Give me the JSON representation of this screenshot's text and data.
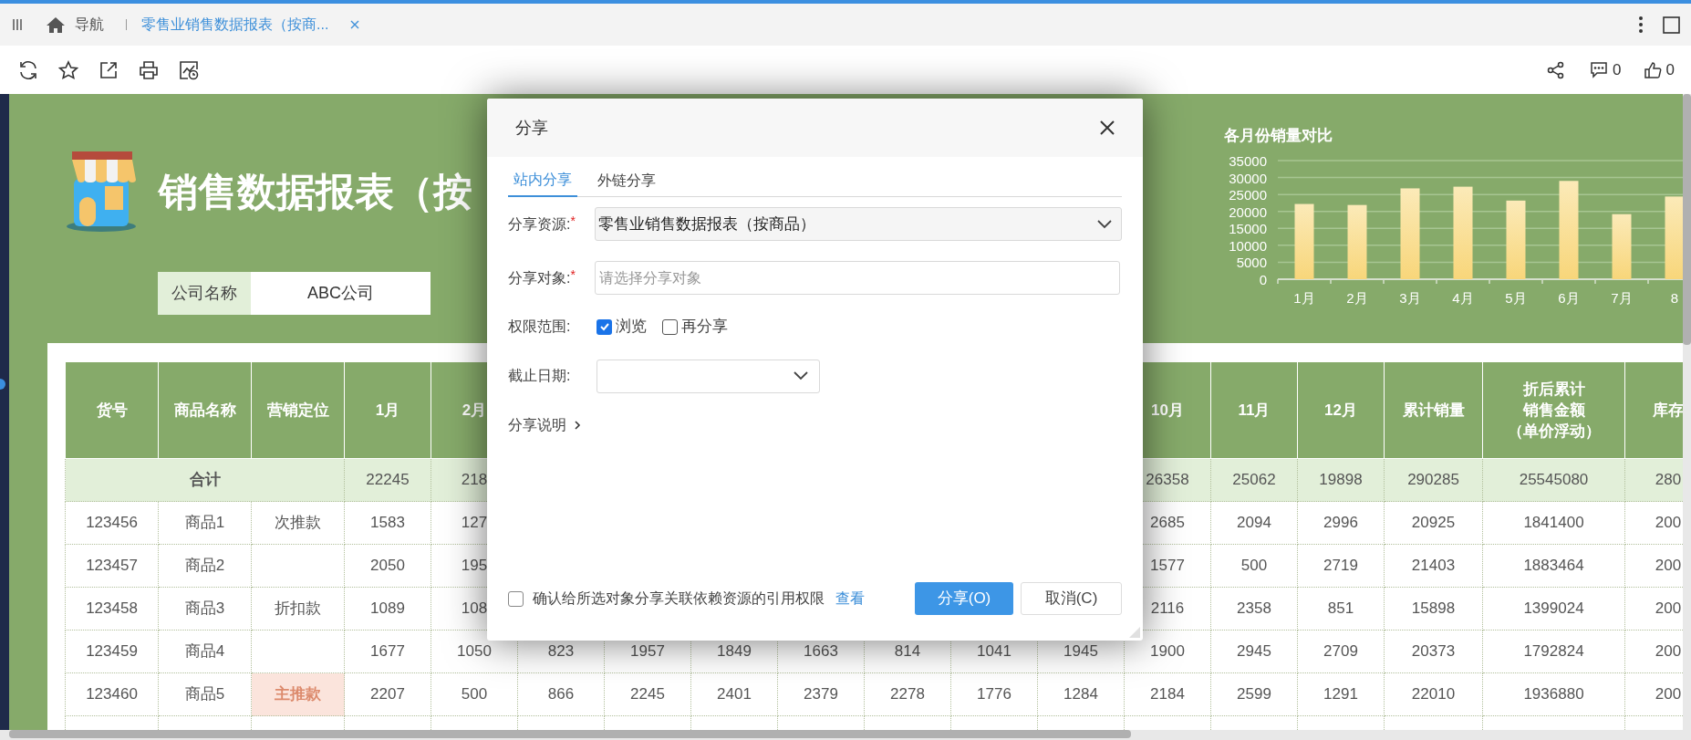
{
  "tab_bar": {
    "nav_label": "导航",
    "tabs": [
      {
        "label": "零售业销售数据报表（按商...",
        "selected": true
      }
    ]
  },
  "toolbar": {
    "comment_count": "0",
    "like_count": "0"
  },
  "report": {
    "title": "销售数据报表（按",
    "company": {
      "label": "公司名称",
      "value": "ABC公司"
    },
    "chart": {
      "chart_data": {
        "type": "bar",
        "title": "各月份销量对比",
        "categories": [
          "1月",
          "2月",
          "3月",
          "4月",
          "5月",
          "6月",
          "7月",
          "8"
        ],
        "series": [
          {
            "color": "#f8d67a",
            "values": [
              22200,
              21900,
              26800,
              27300,
              23200,
              29000,
              19200,
              24400
            ]
          }
        ],
        "ylim": [
          0,
          35000
        ],
        "yticks": [
          0,
          5000,
          10000,
          15000,
          20000,
          25000,
          30000,
          35000
        ],
        "grid": true
      }
    }
  },
  "table": {
    "columns": [
      "货号",
      "商品名称",
      "营销定位",
      "1月",
      "2月"
    ],
    "columns_late": [
      "10月",
      "11月",
      "12月",
      "累计销量",
      {
        "lines": [
          "折后累计",
          "销售金额",
          "（单价浮动）"
        ]
      },
      "库存"
    ],
    "total_row": {
      "label": "合计",
      "months": [
        "22245",
        "218"
      ],
      "months_late": [
        "26358",
        "25062",
        "19898"
      ],
      "total": "290285",
      "amount": "25545080",
      "stock": "280"
    },
    "rows": [
      {
        "code": "123456",
        "name": "商品1",
        "positioning": "次推款",
        "emphasized": false,
        "months": [
          "1583",
          "127"
        ],
        "months_late": [
          "2685",
          "2094",
          "2996"
        ],
        "total": "20925",
        "amount": "1841400",
        "stock": "200"
      },
      {
        "code": "123457",
        "name": "商品2",
        "emphasized": false,
        "months": [
          "2050",
          "195"
        ],
        "months_late": [
          "1577",
          "500",
          "2719"
        ],
        "total": "21403",
        "amount": "1883464",
        "stock": "200"
      },
      {
        "code": "123458",
        "name": "商品3",
        "positioning": "折扣款",
        "emphasized": false,
        "months": [
          "1089",
          "108"
        ],
        "months_late": [
          "2116",
          "2358",
          "851"
        ],
        "total": "15898",
        "amount": "1399024",
        "stock": "200"
      },
      {
        "code": "123459",
        "name": "商品4",
        "emphasized": false,
        "months": [
          "1677",
          "1050",
          "823",
          "1957",
          "1849",
          "1663",
          "814",
          "1041",
          "1945",
          "1900",
          "2945",
          "2709"
        ],
        "total": "20373",
        "amount": "1792824",
        "stock": "200"
      },
      {
        "code": "123460",
        "name": "商品5",
        "positioning": "主推款",
        "emphasized": true,
        "months": [
          "2207",
          "500",
          "866",
          "2245",
          "2401",
          "2379",
          "2278",
          "1776",
          "1284",
          "2184",
          "2599",
          "1291"
        ],
        "total": "22010",
        "amount": "1936880",
        "stock": "200"
      }
    ]
  },
  "dialog": {
    "title": "分享",
    "tabs": [
      {
        "label": "站内分享",
        "selected": true
      },
      {
        "label": "外链分享",
        "selected": false
      }
    ],
    "fields": [
      {
        "kind": "select",
        "label": "分享资源:",
        "required_mark": "*",
        "value": "零售业销售数据报表（按商品）"
      },
      {
        "kind": "input",
        "label": "分享对象:",
        "required_mark": "*",
        "placeholder": "请选择分享对象"
      },
      {
        "kind": "checkboxes",
        "label": "权限范围:",
        "options": [
          {
            "label": "浏览",
            "checked": true
          },
          {
            "label": "再分享",
            "checked": false
          }
        ]
      },
      {
        "kind": "date",
        "label": "截止日期:"
      }
    ],
    "description_toggle": {
      "label": "分享说明",
      "expanded": false
    },
    "footer": {
      "confirm": {
        "label": "确认给所选对象分享关联依赖资源的引用权限",
        "checked": false
      },
      "link": "查看",
      "buttons": [
        {
          "label": "分享(O)",
          "kind": "primary"
        },
        {
          "label": "取消(C)",
          "kind": "secondary"
        }
      ]
    }
  }
}
